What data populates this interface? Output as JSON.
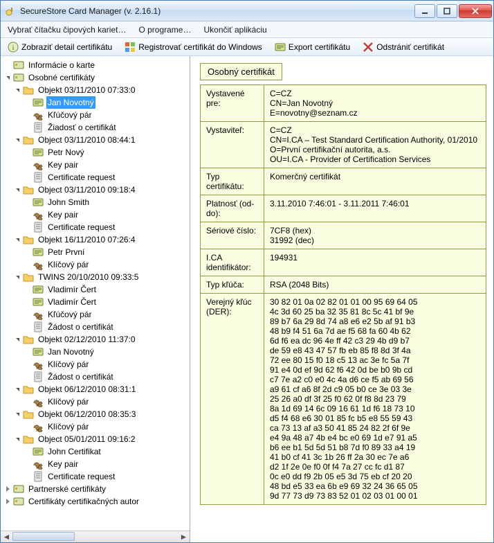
{
  "window": {
    "title": "SecureStore Card Manager (v. 2.16.1)"
  },
  "menu": {
    "reader": "Vybrať čítačku čipových kariet…",
    "about": "O programe…",
    "quit": "Ukončiť aplikáciu"
  },
  "toolbar": {
    "detail": "Zobraziť detail certifikátu",
    "register": "Registrovať certifikát do Windows",
    "export": "Export certifikátu",
    "delete": "Odstrániť certifikát"
  },
  "tree": {
    "info": "Informácie o karte",
    "personal": "Osobné certifikáty",
    "partner": "Partnerské certifikáty",
    "ca": "Certifikáty certifikačných autor",
    "obj1": "Objekt 03/11/2010 07:33:0",
    "obj1_cert": "Jan Novotný",
    "obj1_key": "Kľúčový pár",
    "obj1_req": "Žiadosť o certifikát",
    "obj2": "Object 03/11/2010 08:44:1",
    "obj2_cert": "Petr Nový",
    "obj2_key": "Key pair",
    "obj2_req": "Certificate request",
    "obj3": "Object 03/11/2010 09:18:4",
    "obj3_cert": "John Smith",
    "obj3_key": "Key pair",
    "obj3_req": "Certificate request",
    "obj4": "Objekt 16/11/2010 07:26:4",
    "obj4_cert": "Petr První",
    "obj4_key": "Klíčový pár",
    "obj5": "TWINS 20/10/2010 09:33:5",
    "obj5_cert1": "Vladimír Čert",
    "obj5_cert2": "Vladimír Čert",
    "obj5_key": "Kľúčový pár",
    "obj5_req": "Žádost o certifikát",
    "obj6": "Objekt 02/12/2010 11:37:0",
    "obj6_cert": "Jan Novotný",
    "obj6_key": "Klíčový pár",
    "obj6_req": "Žádost o certifikát",
    "obj7": "Objekt 06/12/2010 08:31:1",
    "obj7_key": "Klíčový pár",
    "obj8": "Objekt 06/12/2010 08:35:3",
    "obj8_key": "Klíčový pár",
    "obj9": "Object 05/01/2011 09:16:2",
    "obj9_cert": "John Certifikat",
    "obj9_key": "Key pair",
    "obj9_req": "Certificate request"
  },
  "detail": {
    "heading": "Osobný certifikát",
    "issued_for_k": "Vystavené pre:",
    "issued_for_v": "C=CZ\nCN=Jan Novotný\nE=novotny@seznam.cz",
    "issuer_k": "Vystaviteľ:",
    "issuer_v": "C=CZ\nCN=I.CA – Test Standard Certification Authority, 01/2010\nO=První certifikační autorita, a.s.\nOU=I.CA - Provider of Certification Services",
    "type_k": "Typ certifikátu:",
    "type_v": "Komerčný certifikát",
    "valid_k": "Platnosť (od-do):",
    "valid_v": "3.11.2010 7:46:01 - 3.11.2011 7:46:01",
    "serial_k": "Sériové číslo:",
    "serial_v": "7CF8 (hex)\n31992 (dec)",
    "icaid_k": "I.CA identifikátor:",
    "icaid_v": "194931",
    "keytype_k": "Typ kľúča:",
    "keytype_v": "RSA (2048 Bits)",
    "pubkey_k": "Verejný kľúc (DER):",
    "pubkey_v": "30 82 01 0a 02 82 01 01 00 95 69 64 05\n4c 3d 60 25 ba 32 35 81 8c 5c 41 bf 9e\n89 b7 6a 29 8d 74 a8 e6 e2 5b af 91 b3\n48 b9 f4 51 6a 7d ae f5 68 fa 60 4b 62\n6d f6 ea dc 96 4e ff 42 c3 29 4b d9 b7\nde 59 e8 43 47 57 fb eb 85 f8 8d 3f 4a\n72 ee 80 15 f0 18 c5 13 ac 3e fc 5a 7f\n91 e4 0d ef 9d 62 f6 42 0d be b0 9b cd\nc7 7e a2 c0 e0 4c 4a d6 ce f5 ab 69 56\na9 61 cf a6 8f 2d c9 05 b0 ce 3e 03 3e\n25 26 a0 df 3f 25 f0 62 0f f8 8d 23 79\n8a 1d 69 14 6c 09 16 61 1d f6 18 73 10\nd5 f4 68 e6 30 01 85 fc b5 e8 55 59 43\nca 73 13 af a3 50 41 85 24 82 2f 6f 9e\ne4 9a 48 a7 4b e4 bc e0 69 1d e7 91 a5\nb6 ee b1 5d 5d 51 b8 7d f0 89 33 a4 19\n41 b0 cf 41 3c 1b 26 ff 2a 30 ec 7e a6\nd2 1f 2e 0e f0 0f f4 7a 27 cc fc d1 87\n0c e0 dd f9 2b 05 e5 3d 75 eb cf 20 20\n48 bd e5 33 ea 6b e9 69 32 24 36 65 05\n9d 77 73 d9 73 83 52 01 02 03 01 00 01"
  }
}
